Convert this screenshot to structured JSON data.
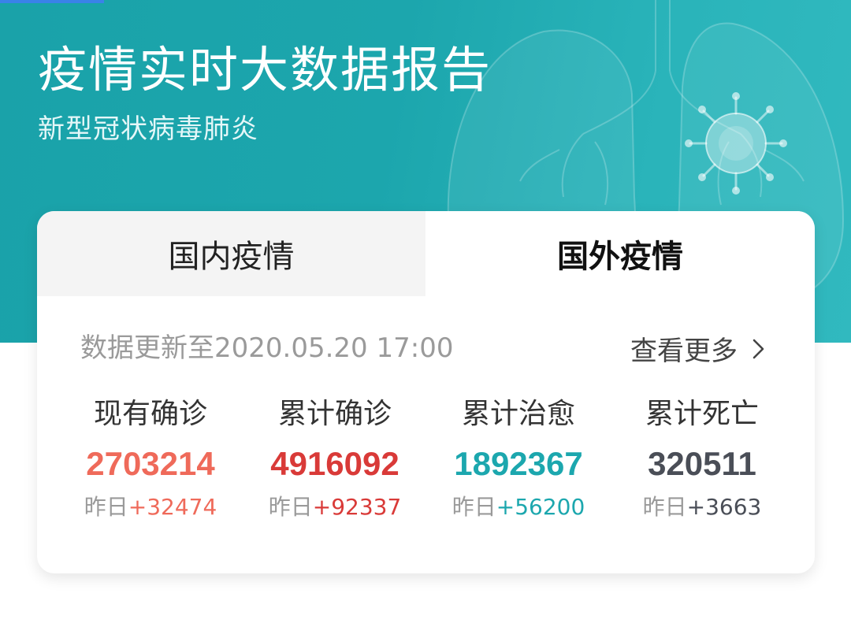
{
  "hero": {
    "title": "疫情实时大数据报告",
    "subtitle": "新型冠状病毒肺炎"
  },
  "tabs": {
    "domestic": "国内疫情",
    "foreign": "国外疫情",
    "active": "foreign"
  },
  "update": {
    "text": "数据更新至2020.05.20 17:00",
    "more_label": "查看更多"
  },
  "stats": [
    {
      "label": "现有确诊",
      "value": "2703214",
      "delta_prefix": "昨日",
      "delta": "+32474",
      "color": "#ef6a5a"
    },
    {
      "label": "累计确诊",
      "value": "4916092",
      "delta_prefix": "昨日",
      "delta": "+92337",
      "color": "#d93a38"
    },
    {
      "label": "累计治愈",
      "value": "1892367",
      "delta_prefix": "昨日",
      "delta": "+56200",
      "color": "#1ca7ae"
    },
    {
      "label": "累计死亡",
      "value": "320511",
      "delta_prefix": "昨日",
      "delta": "+3663",
      "color": "#4a4e57"
    }
  ],
  "colors": {
    "hero_bg": "#1ca6ad",
    "tab_inactive_bg": "#f4f4f4",
    "muted_text": "#9a9a9a"
  },
  "icons": {
    "more": "chevron-right-icon",
    "illustration": "lungs-virus-illustration"
  }
}
